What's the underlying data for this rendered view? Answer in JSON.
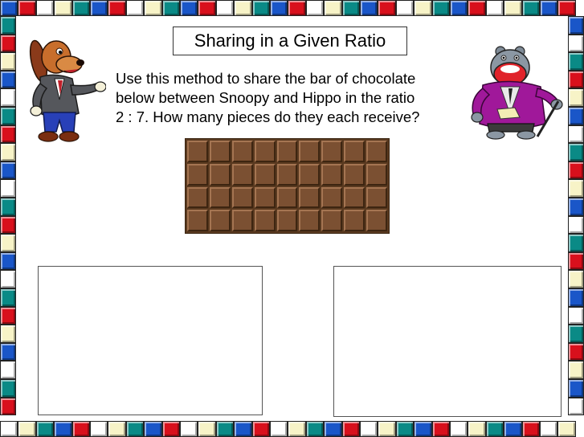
{
  "slide": {
    "title": "Sharing in a Given Ratio",
    "instructions": [
      "Use this method to share the bar of chocolate",
      "below between Snoopy and Hippo in the ratio",
      "2 : 7. How many pieces do they each receive?"
    ]
  },
  "chocolate_bar": {
    "columns": 9,
    "rows": 4
  },
  "border_colors": [
    "#1a56c8",
    "#d8101c",
    "#ffffff",
    "#f7f3c7",
    "#0a8a86"
  ],
  "characters": {
    "left": "dog-cartoon-icon",
    "right": "hippo-cartoon-icon"
  }
}
